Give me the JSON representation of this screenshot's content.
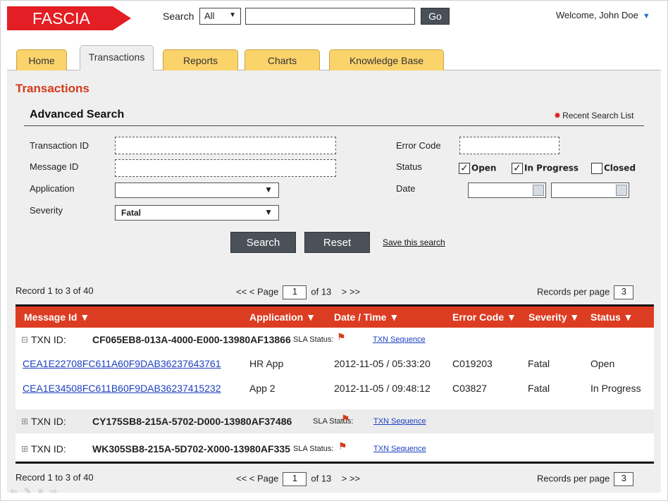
{
  "header": {
    "logo": "FASCIA",
    "search_label": "Search",
    "search_scope": "All",
    "search_value": "",
    "go_label": "Go",
    "welcome": "Welcome, John Doe"
  },
  "tabs": [
    {
      "label": "Home",
      "active": false
    },
    {
      "label": "Transactions",
      "active": true
    },
    {
      "label": "Reports",
      "active": false
    },
    {
      "label": "Charts",
      "active": false
    },
    {
      "label": "Knowledge Base",
      "active": false
    }
  ],
  "page_title": "Transactions",
  "advanced_search": {
    "title": "Advanced Search",
    "recent_search": "Recent Search List",
    "labels": {
      "transaction_id": "Transaction ID",
      "message_id": "Message ID",
      "application": "Application",
      "severity": "Severity",
      "error_code": "Error Code",
      "status": "Status",
      "date": "Date"
    },
    "severity_value": "Fatal",
    "application_value": "",
    "status_options": [
      {
        "label": "Open",
        "checked": true
      },
      {
        "label": "In Progress",
        "checked": true
      },
      {
        "label": "Closed",
        "checked": false
      }
    ],
    "search_button": "Search",
    "reset_button": "Reset",
    "save_link": "Save this search"
  },
  "pager": {
    "records": "Record 1 to 3 of 40",
    "first_prev": "<<  <  Page",
    "page": "1",
    "of_pages": "of 13",
    "next_last": ">  >>",
    "rpp_label": "Records per page",
    "rpp_value": "3"
  },
  "table": {
    "headers": {
      "message_id": "Message Id ▼",
      "application": "Application ▼",
      "datetime": "Date / Time ▼",
      "error_code": "Error Code ▼",
      "severity": "Severity ▼",
      "status": "Status ▼"
    },
    "sla_label": "SLA Status:",
    "sequence_label": "TXN Sequence",
    "txn_prefix": "TXN  ID:",
    "transactions": [
      {
        "id": "CF065EB8-013A-4000-E000-13980AF13866",
        "expanded": true
      },
      {
        "id": "CY175SB8-215A-5702-D000-13980AF37486",
        "expanded": false
      },
      {
        "id": "WK305SB8-215A-5D702-X000-13980AF335",
        "expanded": false
      }
    ],
    "messages": [
      {
        "message_id": "CEA1E22708FC611A60F9DAB36237643761",
        "application": "HR App",
        "datetime": "2012-11-05 / 05:33:20",
        "error_code": "C019203",
        "severity": "Fatal",
        "status": "Open"
      },
      {
        "message_id": "CEA1E34508FC611B60F9DAB36237415232",
        "application": "App 2",
        "datetime": "2012-11-05 / 09:48:12",
        "error_code": "C03827",
        "severity": "Fatal",
        "status": "In Progress"
      }
    ]
  }
}
